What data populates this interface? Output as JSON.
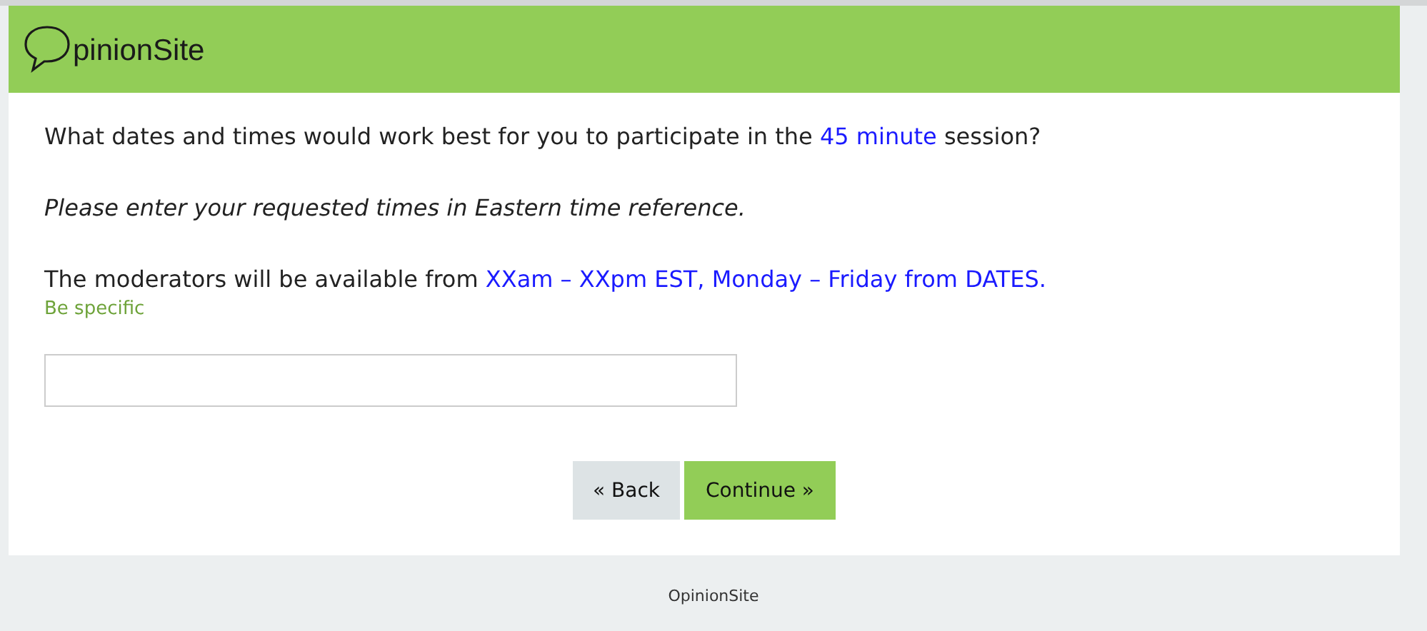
{
  "header": {
    "logo": "pinionSite"
  },
  "question": [
    {
      "text": "What dates and times would work best for you to participate in the ",
      "kind": "plain"
    },
    {
      "text": "45 minute",
      "kind": "highlight"
    },
    {
      "text": " session?",
      "kind": "plain"
    }
  ],
  "instruction": "Please enter your requested times in Eastern time reference.",
  "availability": [
    {
      "text": "The moderators will be available from ",
      "kind": "plain"
    },
    {
      "text": "XXam – XXpm EST, Monday – Friday from DATES.",
      "kind": "highlight"
    }
  ],
  "hint": "Be specific",
  "buttons": [
    {
      "label": "« Back",
      "kind": "secondary"
    },
    {
      "label": "Continue »",
      "kind": "primary"
    }
  ],
  "footer": "OpinionSite"
}
